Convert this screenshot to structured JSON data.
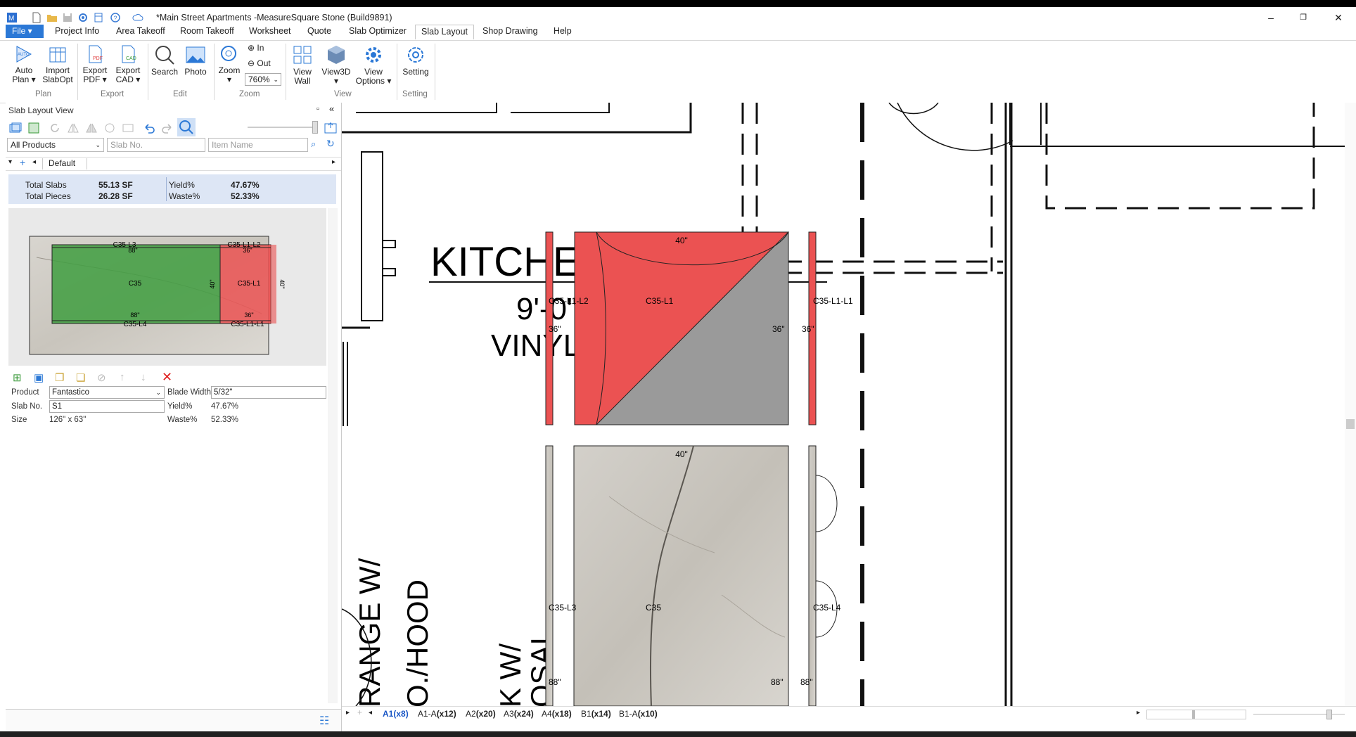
{
  "window": {
    "title": "*Main Street Apartments -MeasureSquare Stone (Build9891)",
    "controls": {
      "minimize": "–",
      "maximize": "❐",
      "close": "✕"
    }
  },
  "menu": {
    "file": "File",
    "tabs": [
      "Project Info",
      "Area Takeoff",
      "Room Takeoff",
      "Worksheet",
      "Quote",
      "Slab Optimizer",
      "Slab Layout",
      "Shop Drawing",
      "Help"
    ],
    "active_tab": "Slab Layout"
  },
  "ribbon": {
    "buttons": {
      "auto_plan": "Auto\nPlan ▾",
      "import_slabopt": "Import\nSlabOpt",
      "export_pdf": "Export\nPDF ▾",
      "export_cad": "Export\nCAD ▾",
      "search": "Search",
      "photo": "Photo",
      "zoom": "Zoom\n▾",
      "zoom_in": "In",
      "zoom_out": "Out",
      "zoom_value": "760%",
      "view_wall": "View\nWall",
      "view3d": "View3D\n▾",
      "view_options": "View\nOptions ▾",
      "setting": "Setting"
    },
    "groups": [
      "Plan",
      "Export",
      "Edit",
      "Zoom",
      "View",
      "Setting"
    ]
  },
  "left_panel": {
    "title": "Slab Layout View",
    "filter": {
      "product": "All Products",
      "slab_no_placeholder": "Slab No.",
      "item_name_placeholder": "Item Name"
    },
    "layer": "Default",
    "stats": {
      "total_slabs_label": "Total Slabs",
      "total_slabs": "55.13 SF",
      "total_pieces_label": "Total Pieces",
      "total_pieces": "26.28 SF",
      "yield_label": "Yield%",
      "yield": "47.67%",
      "waste_label": "Waste%",
      "waste": "52.33%"
    },
    "preview_labels": {
      "top_left": "C35-L3",
      "top_left_dim": "88\"",
      "top_right": "C35-L1-L2",
      "top_right_dim": "36\"",
      "center": "C35",
      "center_dim": "40\"",
      "right_piece": "C35-L1",
      "right_dim": "40\"",
      "bottom_left": "C35-L4",
      "bottom_left_dim": "88\"",
      "bottom_right": "C35-L1-L1",
      "bottom_right_dim": "36\""
    },
    "properties": {
      "product_label": "Product",
      "product": "Fantastico",
      "blade_label": "Blade Width",
      "blade": "5/32\"",
      "slab_no_label": "Slab No.",
      "slab_no": "S1",
      "yield_label": "Yield%",
      "yield": "47.67%",
      "size_label": "Size",
      "size": "126\" x 63\"",
      "waste_label": "Waste%",
      "waste": "52.33%"
    }
  },
  "canvas": {
    "room_text": {
      "kitchen": "KITCHEN",
      "dim": "9'-0\"",
      "vinyl": "VINYL",
      "range": "RANGE W/",
      "hood": "O./HOOD",
      "sink": "K W/",
      "disposal": "OSAL"
    },
    "upper_pieces": {
      "top_dim": "40\"",
      "left_strip": "C35-L1-L2",
      "main": "C35-L1",
      "right_strip": "C35-L1-L1",
      "left_dim": "36\"",
      "inner_dim": "36\"",
      "right_dim": "36\""
    },
    "lower_pieces": {
      "top_dim": "40\"",
      "left_strip": "C35-L3",
      "main": "C35",
      "right_strip": "C35-L4",
      "left_dim": "88\"",
      "inner_dim": "88\"",
      "right_dim": "88\""
    }
  },
  "sheets": [
    {
      "name": "A1",
      "count": "(x8)"
    },
    {
      "name": "A1-A",
      "count": "(x12)"
    },
    {
      "name": "A2",
      "count": "(x20)"
    },
    {
      "name": "A3",
      "count": "(x24)"
    },
    {
      "name": "A4",
      "count": "(x18)"
    },
    {
      "name": "B1",
      "count": "(x14)"
    },
    {
      "name": "B1-A",
      "count": "(x10)"
    }
  ],
  "colors": {
    "accent": "#2b78d6",
    "piece_red": "#eb5252",
    "piece_grey": "#9a9a9a",
    "slab_green": "#3f9e3f",
    "stats_bg": "#dde6f5"
  }
}
